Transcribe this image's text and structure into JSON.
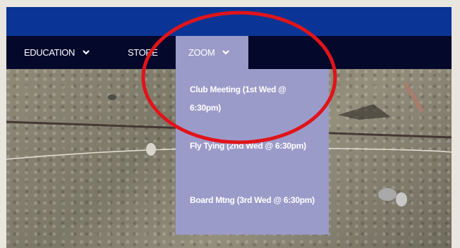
{
  "nav": {
    "items": [
      {
        "label": "EDUCATION",
        "has_dropdown": true
      },
      {
        "label": "STORE",
        "has_dropdown": false
      },
      {
        "label": "ZOOM",
        "has_dropdown": true,
        "active": true
      }
    ]
  },
  "dropdown": {
    "items": [
      {
        "label": "Club Meeting (1st Wed @ 6:30pm)"
      },
      {
        "label": "Fly Tying (2nd Wed @ 6:30pm)"
      },
      {
        "label": "Board Mtng (3rd Wed @ 6:30pm)"
      }
    ]
  },
  "colors": {
    "top_band": "#0a3596",
    "navbar": "#04082b",
    "dropdown": "#9b9bc9",
    "annotation_circle": "#e0141a"
  },
  "icons": {
    "chevron": "chevron-down-icon"
  }
}
